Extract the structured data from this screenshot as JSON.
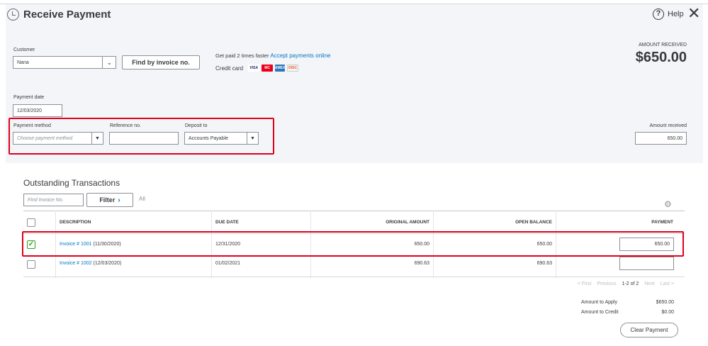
{
  "title": "Receive Payment",
  "help_label": "Help",
  "customer": {
    "label": "Customer",
    "value": "Nana"
  },
  "find_invoice_button": "Find by invoice no.",
  "promo": {
    "text": "Get paid 2 times faster",
    "link": "Accept payments online",
    "credit_card_label": "Credit card",
    "cards": [
      "VISA",
      "MC",
      "AMEX",
      "DISC"
    ]
  },
  "amount_received_header": {
    "label": "AMOUNT RECEIVED",
    "value": "$650.00"
  },
  "payment_date": {
    "label": "Payment date",
    "value": "12/03/2020"
  },
  "payment_method": {
    "label": "Payment method",
    "placeholder": "Choose payment method"
  },
  "reference_no": {
    "label": "Reference no.",
    "value": ""
  },
  "deposit_to": {
    "label": "Deposit to",
    "value": "Accounts Payable"
  },
  "amount_received_field": {
    "label": "Amount received",
    "value": "650.00"
  },
  "outstanding": {
    "title": "Outstanding Transactions",
    "search_placeholder": "Find Invoice No.",
    "filter_label": "Filter",
    "all_label": "All",
    "columns": [
      "DESCRIPTION",
      "DUE DATE",
      "ORIGINAL AMOUNT",
      "OPEN BALANCE",
      "PAYMENT"
    ],
    "rows": [
      {
        "checked": true,
        "link": "Invoice # 1001",
        "date": "(11/30/2020)",
        "due_date": "12/31/2020",
        "original": "650.00",
        "open": "650.00",
        "payment": "650.00"
      },
      {
        "checked": false,
        "link": "Invoice # 1002",
        "date": "(12/03/2020)",
        "due_date": "01/02/2021",
        "original": "690.63",
        "open": "690.63",
        "payment": ""
      }
    ]
  },
  "pagination": {
    "first": "< First",
    "previous": "Previous",
    "range": "1-2 of 2",
    "next": "Next",
    "last": "Last >"
  },
  "totals": {
    "apply_label": "Amount to Apply",
    "apply_value": "$650.00",
    "credit_label": "Amount to Credit",
    "credit_value": "$0.00"
  },
  "clear_payment_button": "Clear Payment"
}
